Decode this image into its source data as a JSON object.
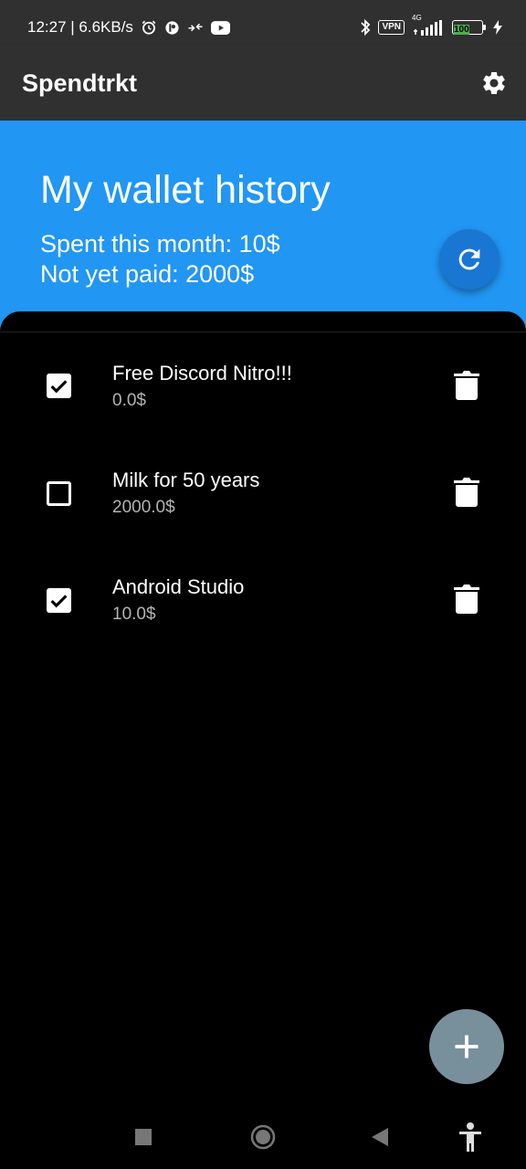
{
  "status_bar": {
    "time_speed": "12:27 | 6.6KB/s",
    "vpn": "VPN",
    "network": "4G",
    "battery": "100"
  },
  "app_bar": {
    "title": "Spendtrkt",
    "settings_icon": "gear-icon"
  },
  "header": {
    "title": "My wallet history",
    "spent_this_month": "Spent this month: 10$",
    "not_yet_paid": "Not yet paid: 2000$",
    "refresh_icon": "refresh-icon",
    "accent_color": "#2196f3"
  },
  "items": [
    {
      "title": "Free Discord Nitro!!!",
      "price": "0.0$",
      "paid": true
    },
    {
      "title": "Milk for 50 years",
      "price": "2000.0$",
      "paid": false
    },
    {
      "title": "Android Studio",
      "price": "10.0$",
      "paid": true
    }
  ],
  "fab": {
    "icon": "plus-icon",
    "color": "#78909c"
  },
  "nav_bar": {
    "icons": [
      "recents-square-icon",
      "home-circle-icon",
      "back-triangle-icon",
      "accessibility-icon"
    ]
  }
}
